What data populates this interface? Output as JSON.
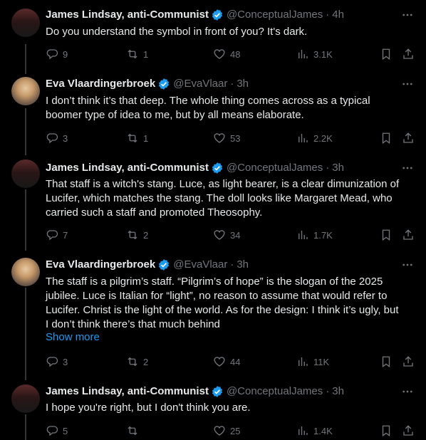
{
  "posts": [
    {
      "name": "James Lindsay, anti-Communist",
      "handle": "@ConceptualJames",
      "time": "4h",
      "text": "Do you understand the symbol in front of you? It's dark.",
      "replies": "9",
      "reposts": "1",
      "likes": "48",
      "views": "3.1K"
    },
    {
      "name": "Eva Vlaardingerbroek",
      "handle": "@EvaVlaar",
      "time": "3h",
      "text": "I don’t think it’s that deep. The whole thing comes across as a typical\nboomer type of idea to me, but by all means elaborate.",
      "replies": "3",
      "reposts": "1",
      "likes": "53",
      "views": "2.2K"
    },
    {
      "name": "James Lindsay, anti-Communist",
      "handle": "@ConceptualJames",
      "time": "3h",
      "text": "That staff is a witch's stang. Luce, as light bearer, is a clear dimunization of\nLucifer, which matches the stang. The doll looks like Margaret Mead, who\ncarried such a staff and promoted Theosophy.",
      "replies": "7",
      "reposts": "2",
      "likes": "34",
      "views": "1.7K"
    },
    {
      "name": "Eva Vlaardingerbroek",
      "handle": "@EvaVlaar",
      "time": "3h",
      "text": "The staff is a pilgrim’s staff. “Pilgrim’s of hope” is the slogan of the 2025\njubilee. Luce is Italian for “light”, no reason to assume that would refer to\nLucifer. Christ is the light of the world. As for the design: I think it’s ugly, but\nI don’t think there’s that much behind",
      "show_more": "Show more",
      "replies": "3",
      "reposts": "2",
      "likes": "44",
      "views": "11K"
    },
    {
      "name": "James Lindsay, anti-Communist",
      "handle": "@ConceptualJames",
      "time": "3h",
      "text": "I hope you're right, but I don't think you are.",
      "replies": "5",
      "reposts": "",
      "likes": "25",
      "views": "1.4K"
    }
  ],
  "colors": {
    "accent": "#1d9bf0",
    "muted": "#71767b",
    "text": "#e7e9ea",
    "background": "#000000"
  },
  "icons": [
    "reply-icon",
    "repost-icon",
    "like-icon",
    "views-icon",
    "bookmark-icon",
    "share-icon",
    "verified-icon",
    "more-icon"
  ]
}
